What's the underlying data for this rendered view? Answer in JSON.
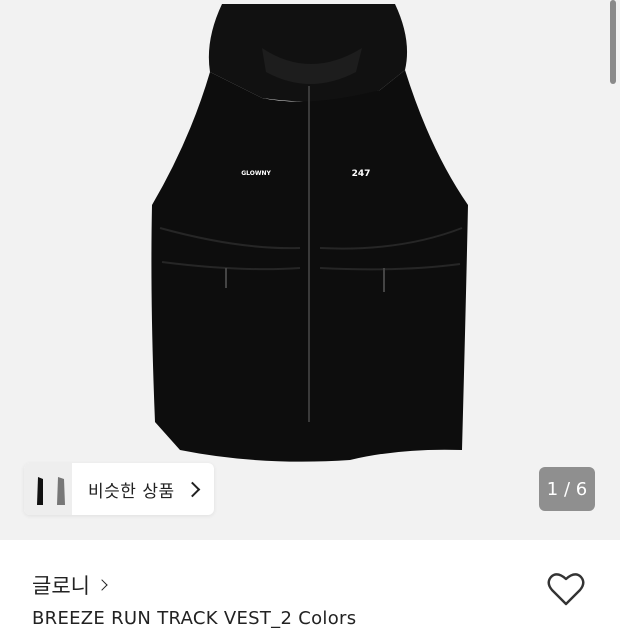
{
  "product_image": {
    "brand_print": "GLOWNY",
    "number_print": "247",
    "colors": {
      "background": "#f2f2f2",
      "garment": "#0d0d0d"
    }
  },
  "similar_products": {
    "label": "비슷한 상품",
    "chevron_icon": "chevron-right-icon"
  },
  "image_counter": {
    "text": "1 / 6",
    "current": 1,
    "total": 6
  },
  "brand": {
    "name": "글로니",
    "chevron_icon": "chevron-right-icon"
  },
  "wishlist": {
    "icon": "heart-outline-icon"
  },
  "product": {
    "title": "BREEZE RUN TRACK VEST_2 Colors"
  }
}
